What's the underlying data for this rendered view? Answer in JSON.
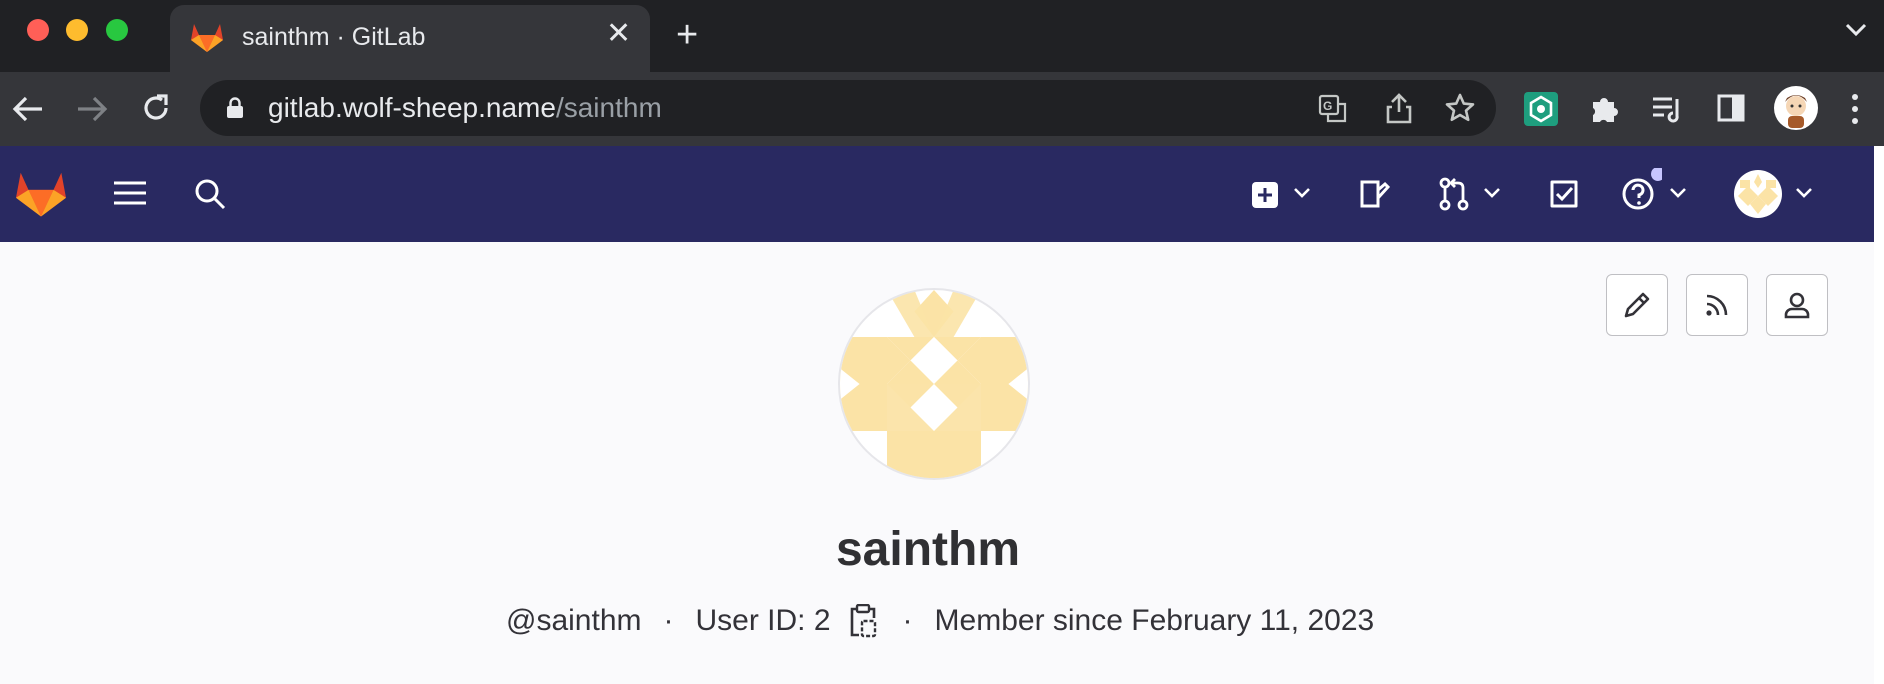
{
  "browser": {
    "tab": {
      "title": "sainthm · GitLab"
    },
    "new_tab_label": "+",
    "close_label": "✕",
    "url": {
      "host": "gitlab.wolf-sheep.name",
      "path": "/sainthm"
    }
  },
  "gitlab": {
    "brand_color": "#292961",
    "header_icons": [
      "gitlab-logo",
      "menu-icon",
      "search-icon",
      "new-item-icon",
      "issues-icon",
      "merge-requests-icon",
      "todos-icon",
      "help-icon",
      "user-avatar"
    ]
  },
  "profile": {
    "name": "sainthm",
    "handle": "@sainthm",
    "user_id": "User ID: 2",
    "member_since": "Member since February 11, 2023",
    "separator": "·",
    "actions": [
      "edit-profile",
      "rss-feed",
      "user-info"
    ]
  },
  "colors": {
    "avatar_pattern": "#fbe3a6",
    "traffic_red": "#ff5f57",
    "traffic_yellow": "#febc2e",
    "traffic_green": "#28c840",
    "extension_green": "#1e9e7e"
  }
}
